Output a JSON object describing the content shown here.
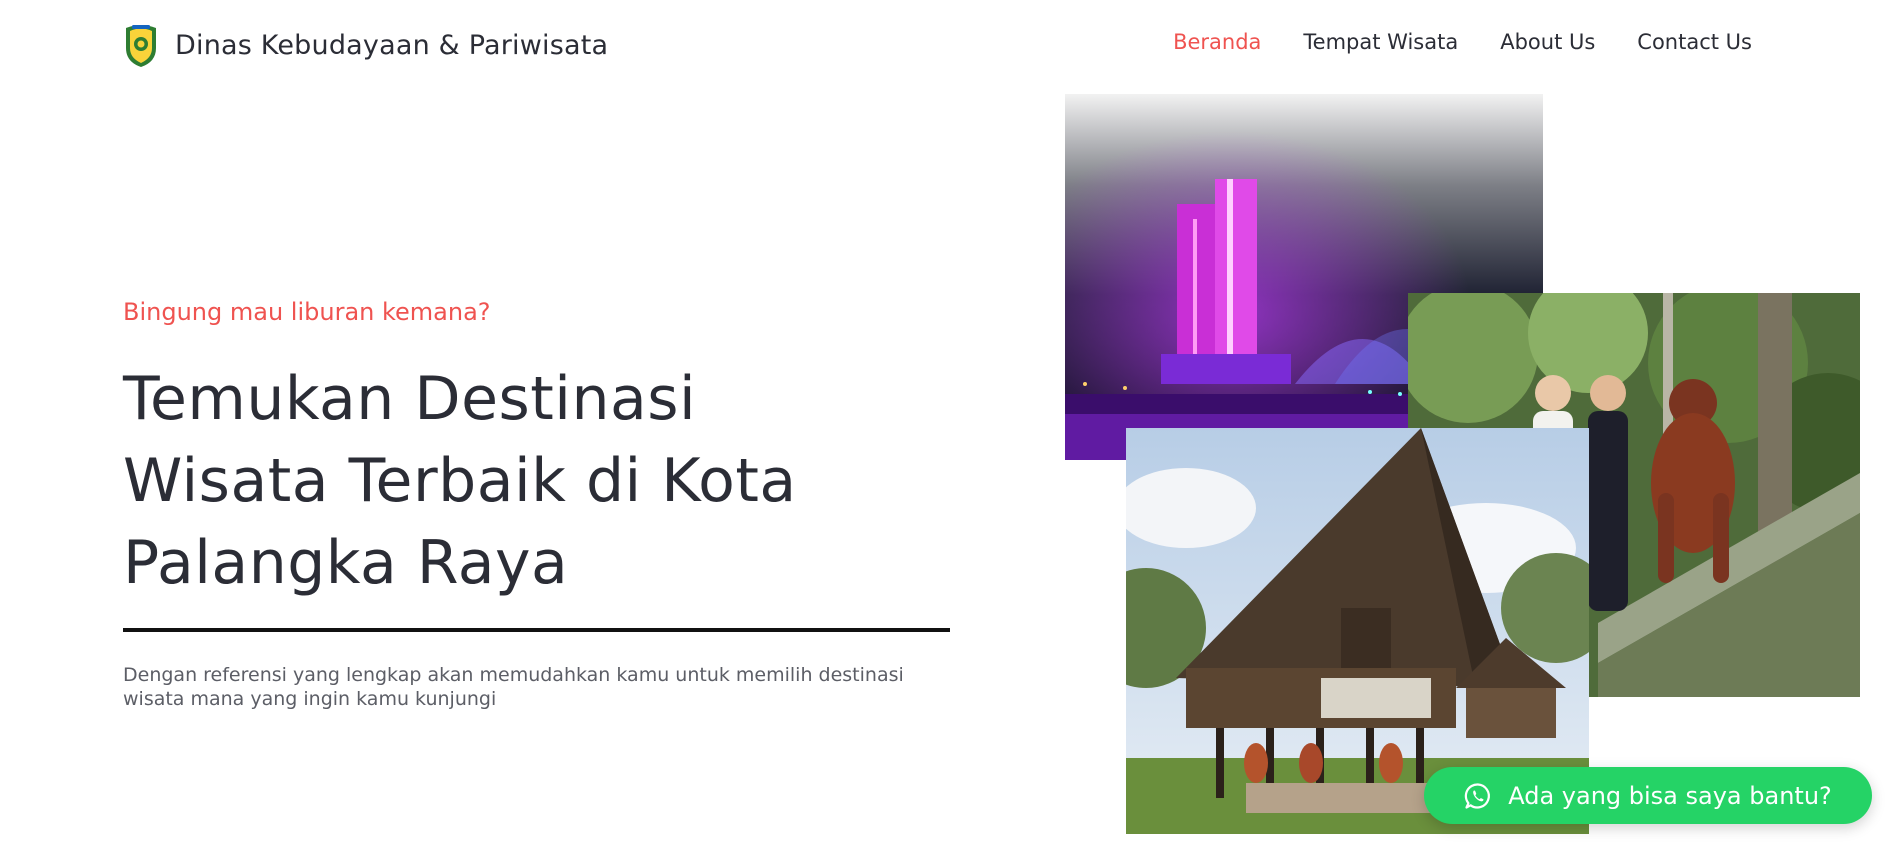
{
  "header": {
    "brand_title": "Dinas Kebudayaan & Pariwisata",
    "logo_icon": "regional-crest-icon",
    "nav": [
      {
        "label": "Beranda",
        "active": true
      },
      {
        "label": "Tempat Wisata",
        "active": false
      },
      {
        "label": "About Us",
        "active": false
      },
      {
        "label": "Contact Us",
        "active": false
      }
    ]
  },
  "hero": {
    "subtitle": "Bingung mau liburan kemana?",
    "headline_line1": "Temukan Destinasi",
    "headline_line2": "Wisata Terbaik di Kota",
    "headline_line3": "Palangka Raya",
    "description": "Dengan referensi yang lengkap akan memudahkan kamu untuk memilih destinasi wisata mana yang ingin kamu kunjungi"
  },
  "cta": {
    "label": "Ada yang bisa saya bantu?",
    "icon": "whatsapp-icon"
  },
  "colors": {
    "accent": "#ef5350",
    "text": "#2b2d36",
    "muted": "#5c5e66",
    "whatsapp": "#25d366"
  }
}
